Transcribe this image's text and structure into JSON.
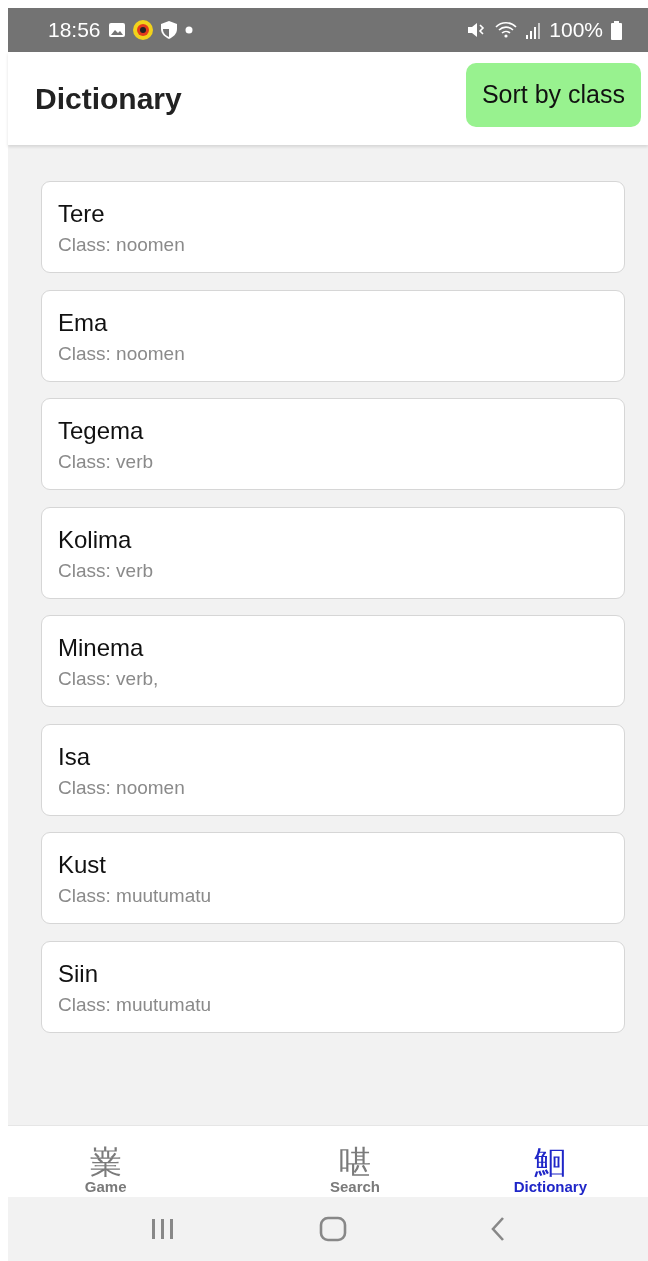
{
  "status_bar": {
    "time": "18:56",
    "battery": "100%"
  },
  "header": {
    "title": "Dictionary",
    "sort_button": "Sort by class"
  },
  "words": [
    {
      "word": "Tere",
      "class": "Class: noomen"
    },
    {
      "word": "Ema",
      "class": "Class: noomen"
    },
    {
      "word": "Tegema",
      "class": "Class: verb"
    },
    {
      "word": "Kolima",
      "class": "Class: verb"
    },
    {
      "word": "Minema",
      "class": "Class: verb,"
    },
    {
      "word": "Isa",
      "class": "Class: noomen"
    },
    {
      "word": "Kust",
      "class": "Class: muutumatu"
    },
    {
      "word": "Siin",
      "class": "Class: muutumatu"
    }
  ],
  "tabs": [
    {
      "glyph": "嶪",
      "label": "Game",
      "selected": false
    },
    {
      "glyph": "啿",
      "label": "Search",
      "selected": false
    },
    {
      "glyph": "鮰",
      "label": "Dictionary",
      "selected": true
    }
  ]
}
